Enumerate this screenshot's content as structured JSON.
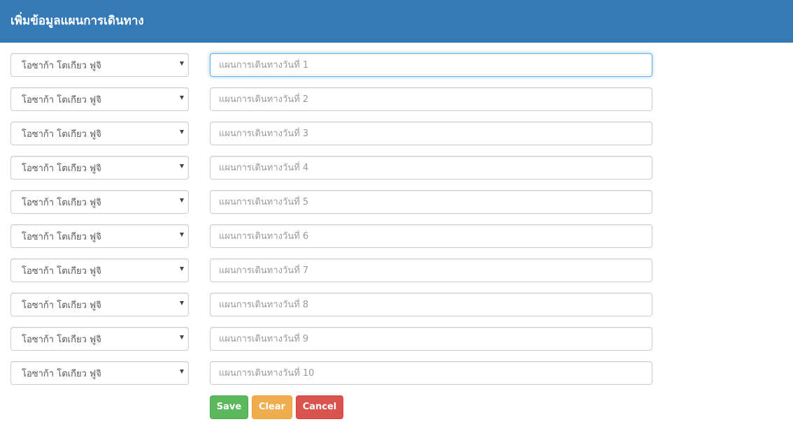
{
  "header": {
    "title": "เพิ่มข้อมูลแผนการเดินทาง"
  },
  "rows": [
    {
      "selected": "โอซาก้า โตเกียว ฟูจิ",
      "placeholder": "แผนการเดินทางวันที่ 1"
    },
    {
      "selected": "โอซาก้า โตเกียว ฟูจิ",
      "placeholder": "แผนการเดินทางวันที่ 2"
    },
    {
      "selected": "โอซาก้า โตเกียว ฟูจิ",
      "placeholder": "แผนการเดินทางวันที่ 3"
    },
    {
      "selected": "โอซาก้า โตเกียว ฟูจิ",
      "placeholder": "แผนการเดินทางวันที่ 4"
    },
    {
      "selected": "โอซาก้า โตเกียว ฟูจิ",
      "placeholder": "แผนการเดินทางวันที่ 5"
    },
    {
      "selected": "โอซาก้า โตเกียว ฟูจิ",
      "placeholder": "แผนการเดินทางวันที่ 6"
    },
    {
      "selected": "โอซาก้า โตเกียว ฟูจิ",
      "placeholder": "แผนการเดินทางวันที่ 7"
    },
    {
      "selected": "โอซาก้า โตเกียว ฟูจิ",
      "placeholder": "แผนการเดินทางวันที่ 8"
    },
    {
      "selected": "โอซาก้า โตเกียว ฟูจิ",
      "placeholder": "แผนการเดินทางวันที่ 9"
    },
    {
      "selected": "โอซาก้า โตเกียว ฟูจิ",
      "placeholder": "แผนการเดินทางวันที่ 10"
    }
  ],
  "actions": {
    "save_label": "Save",
    "clear_label": "Clear",
    "cancel_label": "Cancel"
  },
  "colors": {
    "header": "#337ab7",
    "save": "#5cb85c",
    "clear": "#f0ad4e",
    "cancel": "#d9534f",
    "focus_border": "#66afe9"
  },
  "icons": {
    "select_caret": "caret-down-icon"
  }
}
